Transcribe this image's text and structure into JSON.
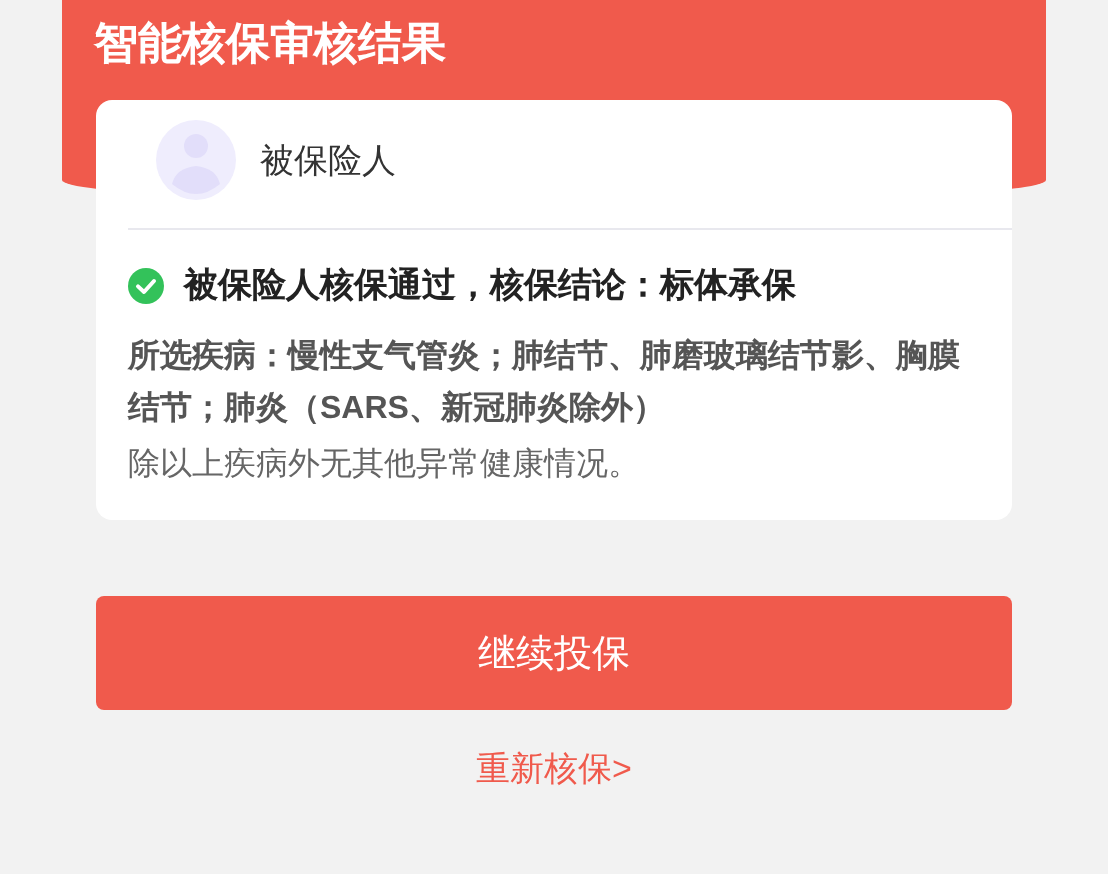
{
  "header": {
    "title": "智能核保审核结果"
  },
  "insured": {
    "label": "被保险人"
  },
  "result": {
    "passed": true,
    "headline": "被保险人核保通过，核保结论：标体承保",
    "diseases": "所选疾病：慢性支气管炎；肺结节、肺磨玻璃结节影、胸膜结节；肺炎（SARS、新冠肺炎除外）",
    "note": "除以上疾病外无其他异常健康情况。"
  },
  "primary_button": "继续投保",
  "retry_link": "重新核保>"
}
